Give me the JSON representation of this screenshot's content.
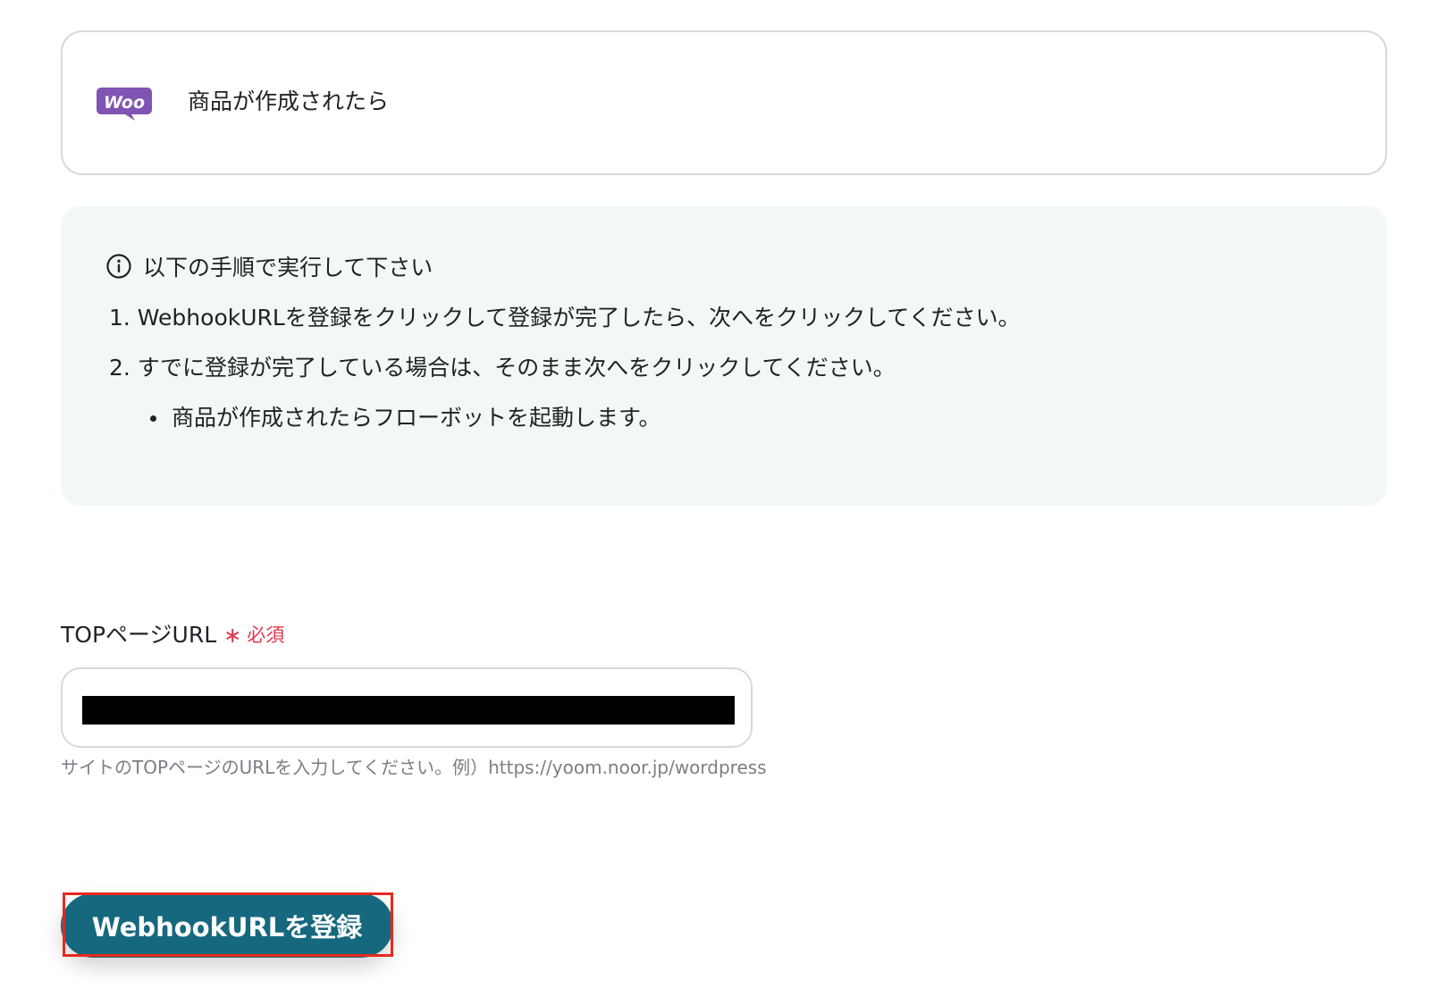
{
  "trigger": {
    "icon": "woocommerce-logo",
    "logo_text": "Woo",
    "label": "商品が作成されたら"
  },
  "instructions": {
    "icon": "info-icon",
    "title": "以下の手順で実行して下さい",
    "steps": [
      "1. WebhookURLを登録をクリックして登録が完了したら、次へをクリックしてください。",
      "2. すでに登録が完了している場合は、そのまま次へをクリックしてください。"
    ],
    "sub_bullet": "商品が作成されたらフローボットを起動します。"
  },
  "field": {
    "label": "TOPページURL",
    "required_mark": "∗",
    "required_text": "必須",
    "value_redacted": true,
    "help": "サイトのTOPページのURLを入力してください。例）https://yoom.noor.jp/wordpress"
  },
  "button": {
    "label": "WebhookURLを登録"
  },
  "colors": {
    "accent": "#16687e",
    "required": "#e2364b",
    "highlight": "#e8291d",
    "woo_purple": "#7f54b3",
    "panel_bg": "#f2f8f8"
  }
}
